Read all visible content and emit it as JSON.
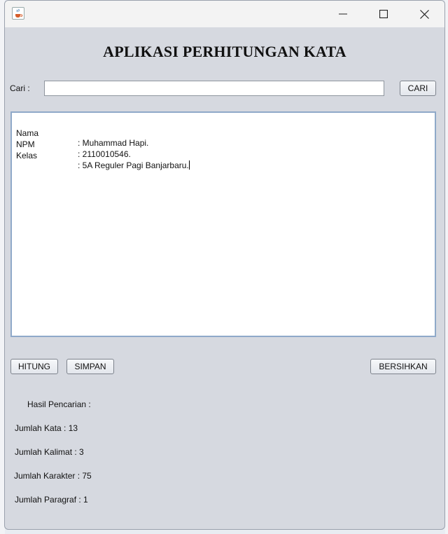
{
  "window": {
    "title_icon": "java-cup-icon",
    "controls": [
      "minimize-icon",
      "maximize-icon",
      "close-icon"
    ]
  },
  "header": {
    "title": "APLIKASI PERHITUNGAN KATA"
  },
  "search": {
    "label": "Cari :",
    "value": "",
    "button": "CARI"
  },
  "editor": {
    "lines": [
      {
        "label": "Nama",
        "value": ": Muhammad Hapi."
      },
      {
        "label": "NPM",
        "value": ": 2110010546."
      },
      {
        "label": "Kelas",
        "value": ": 5A Reguler Pagi Banjarbaru."
      }
    ]
  },
  "actions": {
    "hitung": "HITUNG",
    "simpan": "SIMPAN",
    "bersihkan": "BERSIHKAN"
  },
  "results": {
    "hasil_pencarian": "Hasil Pencarian :",
    "jumlah_kata": "Jumlah Kata : 13",
    "jumlah_kalimat": "Jumlah Kalimat : 3",
    "jumlah_karakter": "Jumlah Karakter : 75",
    "jumlah_paragraf": "Jumlah Paragraf : 1"
  }
}
